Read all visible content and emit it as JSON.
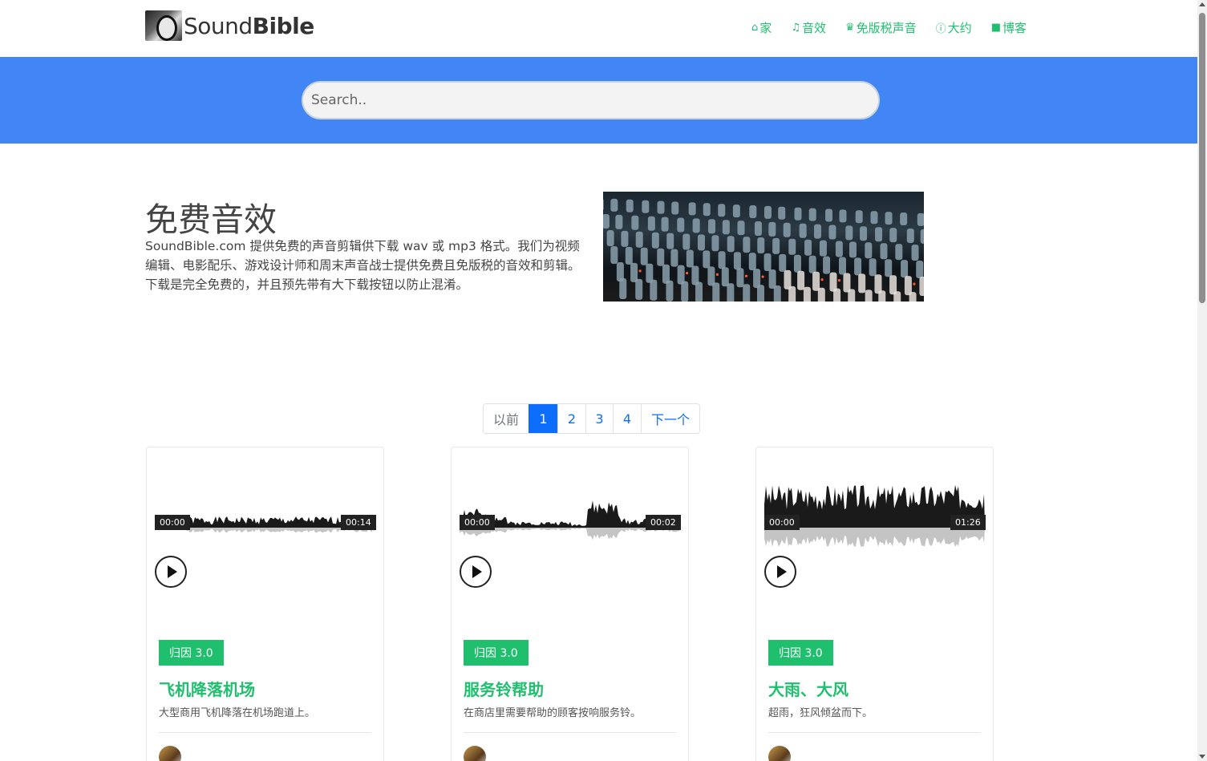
{
  "brand": {
    "name_light": "Sound",
    "name_bold": "Bible"
  },
  "nav": [
    {
      "icon": "home-icon",
      "label": "家"
    },
    {
      "icon": "audio-icon",
      "label": "音效"
    },
    {
      "icon": "crown-icon",
      "label": "免版税声音"
    },
    {
      "icon": "info-icon",
      "label": "大约"
    },
    {
      "icon": "blog-icon",
      "label": "博客"
    }
  ],
  "search": {
    "placeholder": "Search.."
  },
  "intro": {
    "title": "免费音效",
    "text": "SoundBible.com 提供免费的声音剪辑供下载 wav 或 mp3 格式。我们为视频编辑、电影配乐、游戏设计师和周末声音战士提供免费且免版税的音效和剪辑。下载是完全免费的，并且预先带有大下载按钮以防止混淆。"
  },
  "pagination": {
    "prev": "以前",
    "pages": [
      "1",
      "2",
      "3",
      "4"
    ],
    "active": "1",
    "next": "下一个"
  },
  "cards": [
    {
      "start": "00:00",
      "end": "00:14",
      "license": "归因 3.0",
      "title": "飞机降落机场",
      "desc": "大型商用飞机降落在机场跑道上。"
    },
    {
      "start": "00:00",
      "end": "00:02",
      "license": "归因 3.0",
      "title": "服务铃帮助",
      "desc": "在商店里需要帮助的顾客按响服务铃。"
    },
    {
      "start": "00:00",
      "end": "01:26",
      "license": "归因 3.0",
      "title": "大雨、大风",
      "desc": "超雨，狂风倾盆而下。"
    }
  ],
  "colors": {
    "accent": "#1fbf6e",
    "band": "#4285f4",
    "link": "#0d6efd"
  }
}
